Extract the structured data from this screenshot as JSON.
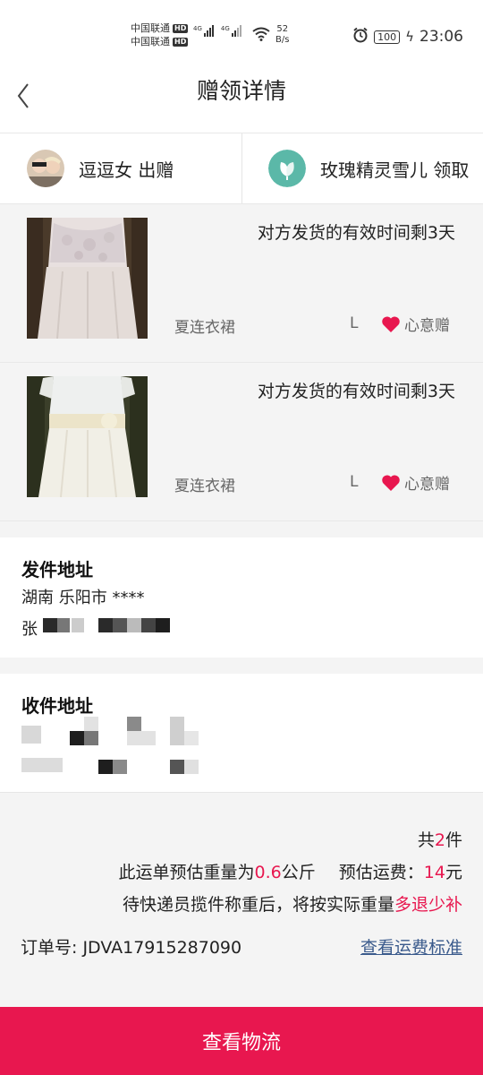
{
  "status_bar": {
    "carrier1": "中国联通",
    "carrier2": "中国联通",
    "hd": "HD",
    "net1": "4G",
    "net2": "4G",
    "speed_value": "52",
    "speed_unit": "B/s",
    "battery": "100",
    "time": "23:06"
  },
  "header": {
    "title": "赠领详情"
  },
  "parties": {
    "giver": "逗逗女 出赠",
    "receiver": "玫瑰精灵雪儿 领取"
  },
  "items": [
    {
      "deadline": "对方发货的有效时间剩3天",
      "category": "夏连衣裙",
      "size": "L",
      "gift_type": "心意赠"
    },
    {
      "deadline": "对方发货的有效时间剩3天",
      "category": "夏连衣裙",
      "size": "L",
      "gift_type": "心意赠"
    }
  ],
  "sender": {
    "label": "发件地址",
    "line1": "湖南 乐阳市 ****",
    "line2": "张"
  },
  "receiver_addr": {
    "label": "收件地址"
  },
  "summary": {
    "count_prefix": "共",
    "count": "2",
    "count_suffix": "件",
    "weight_prefix": "此运单预估重量为",
    "weight": "0.6",
    "weight_unit": "公斤",
    "fee_label": "预估运费：",
    "fee": "14",
    "fee_unit": "元",
    "note_prefix": "待快递员揽件称重后，将按实际重量",
    "note_highlight": "多退少补",
    "order_label": "订单号:",
    "order_no": "JDVA17915287090",
    "fee_standard_link": "查看运费标准"
  },
  "bottom_button": "查看物流",
  "colors": {
    "accent": "#e8174f",
    "link": "#3a5a8c"
  }
}
